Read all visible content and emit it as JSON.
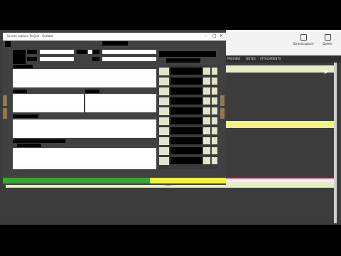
{
  "window": {
    "title": "Screen capture Project - Grabber",
    "min_glyph": "–",
    "max_glyph": "□",
    "close_glyph": "✕"
  },
  "toolbar": {
    "screen_capture_label": "Screencapture",
    "delete_label": "Delete"
  },
  "tabs": [
    "PREVIEW",
    "NOTES",
    "ATTACHMENTS"
  ],
  "progress": {
    "complete_fraction": 0.66,
    "bar_color": "#3aa531",
    "remaining_color": "#f5f43e"
  },
  "colors": {
    "accent_green": "#3aa531",
    "accent_yellow": "#f1f47e",
    "pale_green": "#e6ecc4",
    "pink": "#e47aa0"
  },
  "handle_glyph": "••••"
}
